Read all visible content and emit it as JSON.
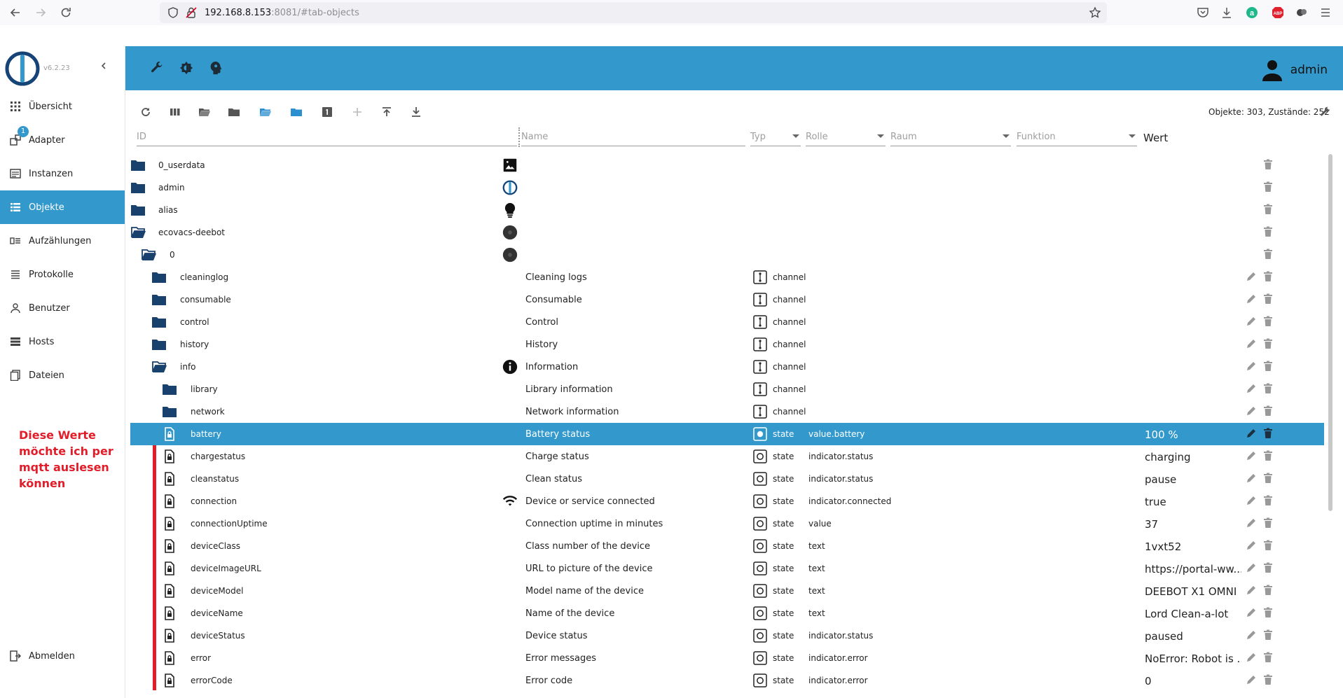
{
  "browser": {
    "url_host": "192.168.8.153",
    "url_rest": ":8081/#tab-objects"
  },
  "app": {
    "version": "v6.2.23"
  },
  "sidebar": {
    "items": [
      {
        "label": "Übersicht",
        "icon": "grid-icon"
      },
      {
        "label": "Adapter",
        "icon": "adapter-icon",
        "badge": "1"
      },
      {
        "label": "Instanzen",
        "icon": "instances-icon"
      },
      {
        "label": "Objekte",
        "icon": "list-icon",
        "active": true
      },
      {
        "label": "Aufzählungen",
        "icon": "enums-icon"
      },
      {
        "label": "Protokolle",
        "icon": "log-icon"
      },
      {
        "label": "Benutzer",
        "icon": "user-icon"
      },
      {
        "label": "Hosts",
        "icon": "hosts-icon"
      },
      {
        "label": "Dateien",
        "icon": "files-icon"
      }
    ],
    "logout": "Abmelden",
    "annotation": "Diese Werte möchte ich per mqtt auslesen können"
  },
  "header": {
    "user": "admin",
    "accent": "#3399cc"
  },
  "objects": {
    "stats": "Objekte: 303, Zustände: 252",
    "filters": {
      "id": "ID",
      "name": "Name",
      "type": "Typ",
      "role": "Rolle",
      "room": "Raum",
      "function": "Funktion"
    },
    "value_header": "Wert",
    "rows": [
      {
        "id": "0_userdata",
        "level": 0,
        "icon": "folder",
        "name": "",
        "nameicon": "image",
        "type": "",
        "role": "",
        "value": ""
      },
      {
        "id": "admin",
        "level": 0,
        "icon": "folder",
        "name": "",
        "nameicon": "iob",
        "type": "",
        "role": "",
        "value": ""
      },
      {
        "id": "alias",
        "level": 0,
        "icon": "folder",
        "name": "",
        "nameicon": "bulb",
        "type": "",
        "role": "",
        "value": ""
      },
      {
        "id": "ecovacs-deebot",
        "level": 0,
        "icon": "folder-open",
        "name": "",
        "nameicon": "robot",
        "type": "",
        "role": "",
        "value": ""
      },
      {
        "id": "0",
        "level": 1,
        "icon": "folder-open",
        "name": "",
        "nameicon": "robot",
        "type": "",
        "role": "",
        "value": ""
      },
      {
        "id": "cleaninglog",
        "level": 2,
        "icon": "folder",
        "name": "Cleaning logs",
        "nameicon": "",
        "type": "channel",
        "role": "",
        "value": ""
      },
      {
        "id": "consumable",
        "level": 2,
        "icon": "folder",
        "name": "Consumable",
        "nameicon": "",
        "type": "channel",
        "role": "",
        "value": ""
      },
      {
        "id": "control",
        "level": 2,
        "icon": "folder",
        "name": "Control",
        "nameicon": "",
        "type": "channel",
        "role": "",
        "value": ""
      },
      {
        "id": "history",
        "level": 2,
        "icon": "folder",
        "name": "History",
        "nameicon": "",
        "type": "channel",
        "role": "",
        "value": ""
      },
      {
        "id": "info",
        "level": 2,
        "icon": "folder-open",
        "name": "Information",
        "nameicon": "info",
        "type": "channel",
        "role": "",
        "value": ""
      },
      {
        "id": "library",
        "level": 3,
        "icon": "folder",
        "name": "Library information",
        "nameicon": "",
        "type": "channel",
        "role": "",
        "value": ""
      },
      {
        "id": "network",
        "level": 3,
        "icon": "folder",
        "name": "Network information",
        "nameicon": "",
        "type": "channel",
        "role": "",
        "value": ""
      },
      {
        "id": "battery",
        "level": 3,
        "icon": "file",
        "name": "Battery status",
        "nameicon": "",
        "type": "state",
        "role": "value.battery",
        "value": "100 %",
        "selected": true
      },
      {
        "id": "chargestatus",
        "level": 3,
        "icon": "file",
        "name": "Charge status",
        "nameicon": "",
        "type": "state",
        "role": "indicator.status",
        "value": "charging"
      },
      {
        "id": "cleanstatus",
        "level": 3,
        "icon": "file",
        "name": "Clean status",
        "nameicon": "",
        "type": "state",
        "role": "indicator.status",
        "value": "pause"
      },
      {
        "id": "connection",
        "level": 3,
        "icon": "file",
        "name": "Device or service connected",
        "nameicon": "wifi",
        "type": "state",
        "role": "indicator.connected",
        "value": "true"
      },
      {
        "id": "connectionUptime",
        "level": 3,
        "icon": "file",
        "name": "Connection uptime in minutes",
        "nameicon": "",
        "type": "state",
        "role": "value",
        "value": "37"
      },
      {
        "id": "deviceClass",
        "level": 3,
        "icon": "file",
        "name": "Class number of the device",
        "nameicon": "",
        "type": "state",
        "role": "text",
        "value": "1vxt52"
      },
      {
        "id": "deviceImageURL",
        "level": 3,
        "icon": "file",
        "name": "URL to picture of the device",
        "nameicon": "",
        "type": "state",
        "role": "text",
        "value": "https://portal-ww...."
      },
      {
        "id": "deviceModel",
        "level": 3,
        "icon": "file",
        "name": "Model name of the device",
        "nameicon": "",
        "type": "state",
        "role": "text",
        "value": "DEEBOT X1 OMNI"
      },
      {
        "id": "deviceName",
        "level": 3,
        "icon": "file",
        "name": "Name of the device",
        "nameicon": "",
        "type": "state",
        "role": "text",
        "value": "Lord Clean-a-lot"
      },
      {
        "id": "deviceStatus",
        "level": 3,
        "icon": "file",
        "name": "Device status",
        "nameicon": "",
        "type": "state",
        "role": "indicator.status",
        "value": "paused"
      },
      {
        "id": "error",
        "level": 3,
        "icon": "file",
        "name": "Error messages",
        "nameicon": "",
        "type": "state",
        "role": "indicator.error",
        "value": "NoError: Robot is ..."
      },
      {
        "id": "errorCode",
        "level": 3,
        "icon": "file",
        "name": "Error code",
        "nameicon": "",
        "type": "state",
        "role": "indicator.error",
        "value": "0"
      }
    ]
  }
}
